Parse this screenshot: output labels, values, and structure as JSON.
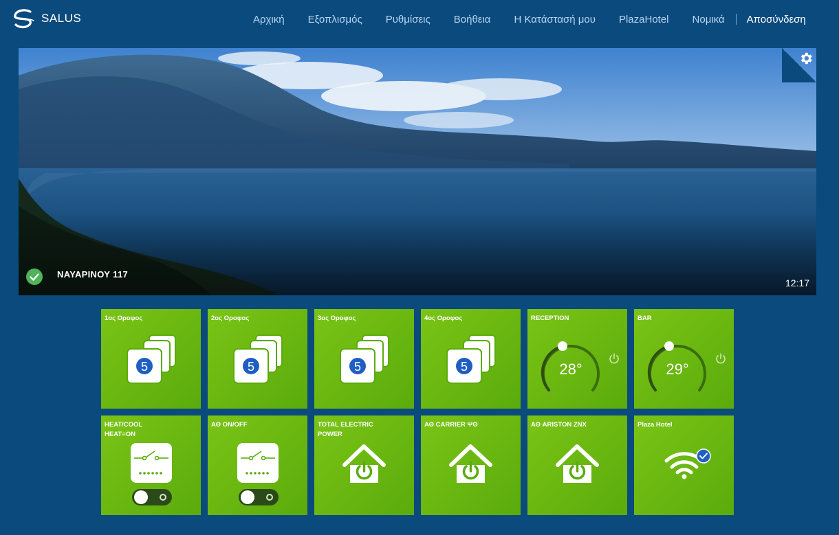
{
  "brand": {
    "name": "SALUS",
    "icon": "salus-swirl-icon"
  },
  "nav": {
    "items": [
      "Αρχική",
      "Εξοπλισμός",
      "Ρυθμίσεις",
      "Βοήθεια",
      "Η Κατάστασή μου",
      "PlazaHotel",
      "Νομικά"
    ],
    "logout": "Αποσύνδεση"
  },
  "hero": {
    "location": "ΝΑΥΑΡΙΝΟΥ 117",
    "time": "12:17",
    "status_icon": "check-circle-icon",
    "settings_icon": "gear-icon"
  },
  "tiles": [
    {
      "label": "1ος Οροφος",
      "type": "group",
      "count": "5",
      "icon": "device-group-icon"
    },
    {
      "label": "2ος Οροφος",
      "type": "group",
      "count": "5",
      "icon": "device-group-icon"
    },
    {
      "label": "3ος Οροφος",
      "type": "group",
      "count": "5",
      "icon": "device-group-icon"
    },
    {
      "label": "4ος Οροφος",
      "type": "group",
      "count": "5",
      "icon": "device-group-icon"
    },
    {
      "label": "RECEPTION",
      "type": "thermostat",
      "temp": "28°",
      "icon": "power-icon"
    },
    {
      "label": "BAR",
      "type": "thermostat",
      "temp": "29°",
      "icon": "power-icon"
    },
    {
      "label": "HEAT/COOL HEAT=ON",
      "type": "relay",
      "icon": "relay-switch-icon"
    },
    {
      "label": "ΑΘ ON/OFF",
      "type": "relay",
      "icon": "relay-switch-icon"
    },
    {
      "label": "TOTAL ELECTRIC POWER",
      "type": "smartplug",
      "icon": "house-power-icon"
    },
    {
      "label": "ΑΘ CARRIER ΨΘ",
      "type": "smartplug",
      "icon": "house-power-icon"
    },
    {
      "label": "ΑΘ ARISTON ZNX",
      "type": "smartplug",
      "icon": "house-power-icon"
    },
    {
      "label": "Plaza Hotel",
      "type": "gateway",
      "icon": "wifi-icon"
    }
  ],
  "colors": {
    "background": "#0b4a7d",
    "tile": "#6ab812",
    "nav_text": "#b8d6f0"
  }
}
